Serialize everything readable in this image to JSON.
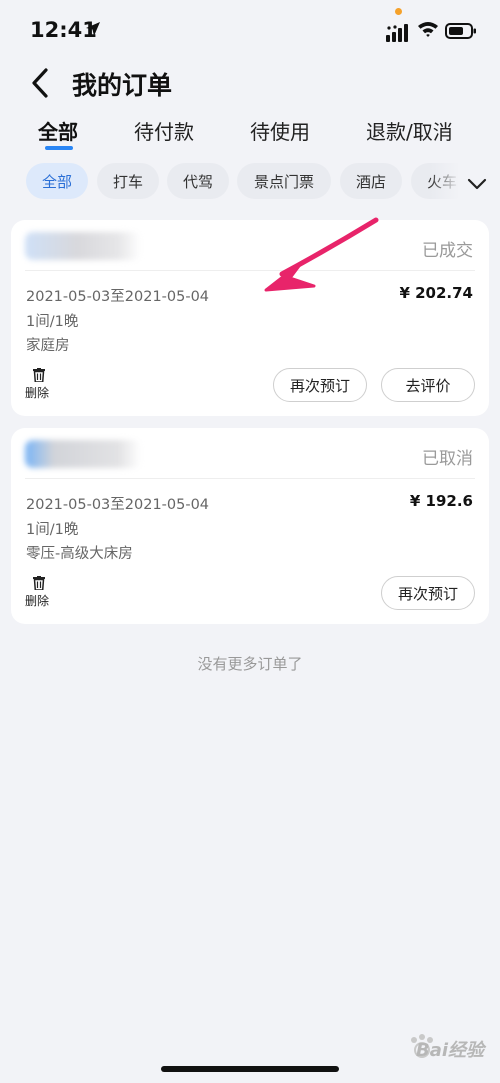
{
  "status_bar": {
    "time": "12:41"
  },
  "header": {
    "title": "我的订单"
  },
  "tabs": [
    {
      "label": "全部",
      "active": true
    },
    {
      "label": "待付款",
      "active": false
    },
    {
      "label": "待使用",
      "active": false
    },
    {
      "label": "退款/取消",
      "active": false
    }
  ],
  "filters": [
    {
      "label": "全部",
      "active": true
    },
    {
      "label": "打车",
      "active": false
    },
    {
      "label": "代驾",
      "active": false
    },
    {
      "label": "景点门票",
      "active": false
    },
    {
      "label": "酒店",
      "active": false
    },
    {
      "label": "火车",
      "active": false
    }
  ],
  "orders": [
    {
      "status": "已成交",
      "dates": "2021-05-03至2021-05-04",
      "price": "¥ 202.74",
      "rooms": "1间/1晚",
      "room_type": "家庭房",
      "delete_label": "删除",
      "buttons": [
        "再次预订",
        "去评价"
      ]
    },
    {
      "status": "已取消",
      "dates": "2021-05-03至2021-05-04",
      "price": "¥ 192.6",
      "rooms": "1间/1晚",
      "room_type": "零压-高级大床房",
      "delete_label": "删除",
      "buttons": [
        "再次预订"
      ]
    }
  ],
  "footer_text": "没有更多订单了",
  "watermark": "Bai经验",
  "colors": {
    "accent": "#2a86f5",
    "annotation_arrow": "#e8246a",
    "background": "#f2f3f7"
  },
  "icons": [
    "back-arrow-icon",
    "location-arrow-icon",
    "signal-icon",
    "wifi-icon",
    "battery-icon",
    "chevron-down-icon",
    "trash-icon"
  ]
}
